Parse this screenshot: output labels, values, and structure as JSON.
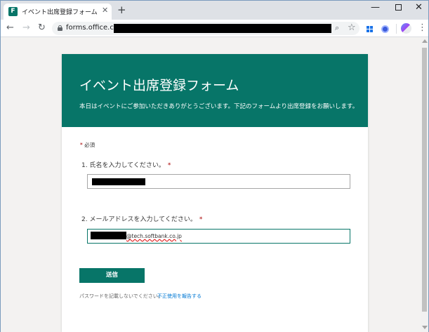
{
  "browser": {
    "tab_title": "イベント出席登録フォーム",
    "tab_favicon_letter": "F",
    "new_tab_symbol": "+",
    "close_symbol": "✕",
    "url": "forms.office.com/",
    "nav": {
      "back": "←",
      "forward": "→",
      "reload": "C"
    },
    "menu_symbol": "⋮"
  },
  "form": {
    "title": "イベント出席登録フォーム",
    "description": "本日はイベントにご参加いただきありがとうございます。下記のフォームより出席登録をお願いします。",
    "required_star": "*",
    "required_note": "必須",
    "questions": [
      {
        "label": "1. 氏名を入力してください。",
        "value": ""
      },
      {
        "label": "2. メールアドレスを入力してください。",
        "value": "@tech.softbank.co.jp"
      }
    ],
    "submit_label": "送信",
    "footer_note": "パスワードを記載しないでください。",
    "report_link": "不正使用を報告する"
  },
  "colors": {
    "brand": "#077568",
    "required": "#a80000",
    "link": "#0078d4"
  }
}
